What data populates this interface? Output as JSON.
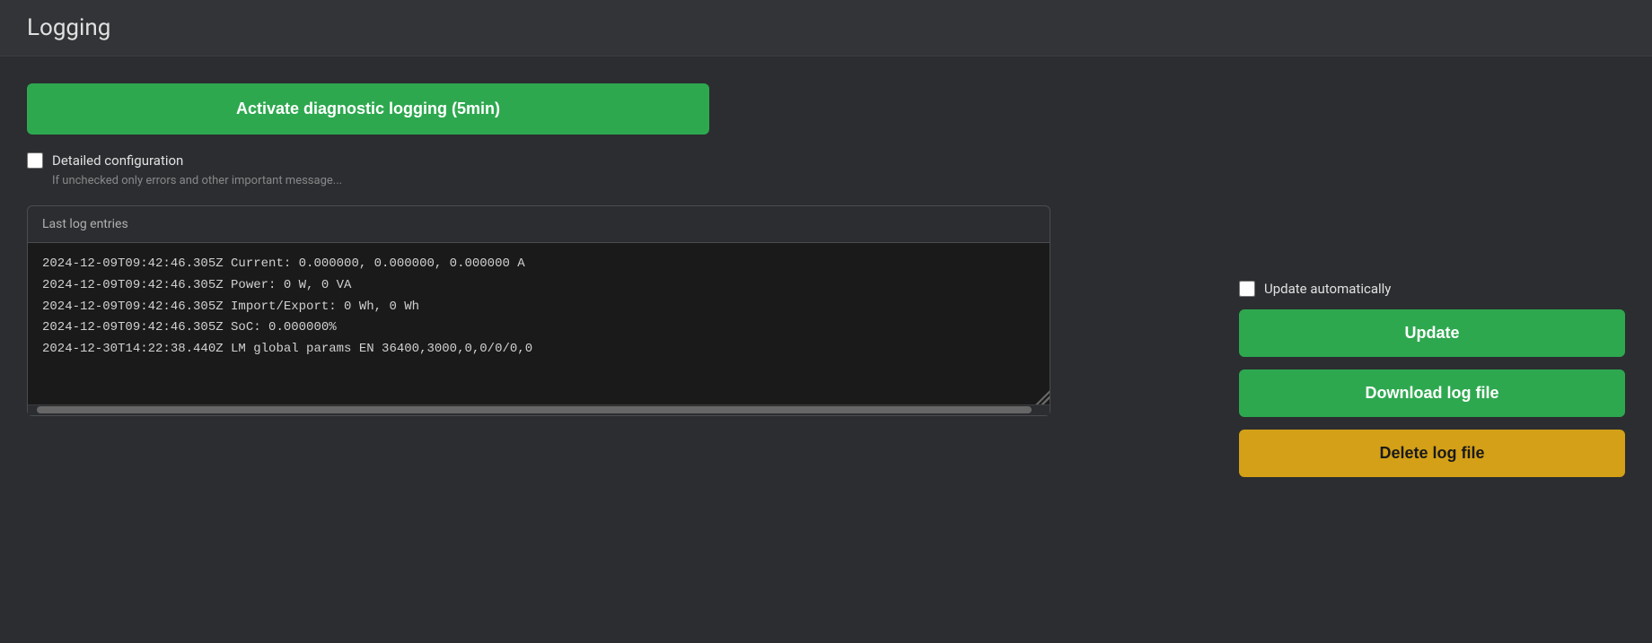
{
  "header": {
    "title": "Logging"
  },
  "left": {
    "activate_btn_label": "Activate diagnostic logging (5min)",
    "detailed_config": {
      "label": "Detailed configuration",
      "hint": "If unchecked only errors and other important message...",
      "checked": false
    },
    "log_entries": {
      "header": "Last log entries",
      "lines": [
        "2024-12-09T09:42:46.305Z Current: 0.000000, 0.000000, 0.000000 A",
        "2024-12-09T09:42:46.305Z Power: 0 W, 0 VA",
        "2024-12-09T09:42:46.305Z Import/Export: 0 Wh, 0 Wh",
        "2024-12-09T09:42:46.305Z SoC: 0.000000%",
        "2024-12-30T14:22:38.440Z LM global params EN 36400,3000,0,0/0/0,0"
      ]
    }
  },
  "right": {
    "update_auto": {
      "label": "Update automatically",
      "checked": false
    },
    "update_btn_label": "Update",
    "download_btn_label": "Download log file",
    "delete_btn_label": "Delete log file"
  }
}
